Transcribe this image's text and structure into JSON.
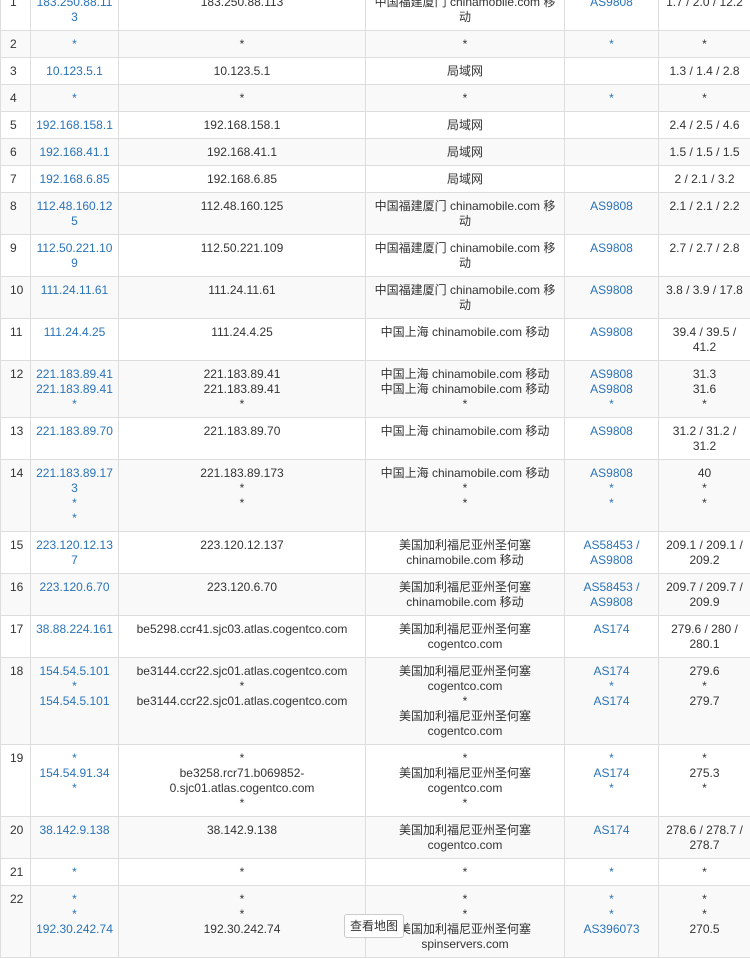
{
  "rows": [
    {
      "no": "1",
      "ip": [
        "183.250.88.113"
      ],
      "host": [
        "183.250.88.113"
      ],
      "loc": [
        "中国福建厦门 chinamobile.com 移动"
      ],
      "as": [
        "AS9808"
      ],
      "time": [
        "1.7 / 2.0 / 12.2"
      ]
    },
    {
      "no": "2",
      "ip": [
        "*"
      ],
      "host": [
        "*"
      ],
      "loc": [
        "*"
      ],
      "as": [
        "*"
      ],
      "time": [
        "*"
      ]
    },
    {
      "no": "3",
      "ip": [
        "10.123.5.1"
      ],
      "host": [
        "10.123.5.1"
      ],
      "loc": [
        "局域网"
      ],
      "as": [
        ""
      ],
      "time": [
        "1.3 / 1.4 / 2.8"
      ]
    },
    {
      "no": "4",
      "ip": [
        "*"
      ],
      "host": [
        "*"
      ],
      "loc": [
        "*"
      ],
      "as": [
        "*"
      ],
      "time": [
        "*"
      ]
    },
    {
      "no": "5",
      "ip": [
        "192.168.158.1"
      ],
      "host": [
        "192.168.158.1"
      ],
      "loc": [
        "局域网"
      ],
      "as": [
        ""
      ],
      "time": [
        "2.4 / 2.5 / 4.6"
      ]
    },
    {
      "no": "6",
      "ip": [
        "192.168.41.1"
      ],
      "host": [
        "192.168.41.1"
      ],
      "loc": [
        "局域网"
      ],
      "as": [
        ""
      ],
      "time": [
        "1.5 / 1.5 / 1.5"
      ]
    },
    {
      "no": "7",
      "ip": [
        "192.168.6.85"
      ],
      "host": [
        "192.168.6.85"
      ],
      "loc": [
        "局域网"
      ],
      "as": [
        ""
      ],
      "time": [
        "2 / 2.1 / 3.2"
      ]
    },
    {
      "no": "8",
      "ip": [
        "112.48.160.125"
      ],
      "host": [
        "112.48.160.125"
      ],
      "loc": [
        "中国福建厦门 chinamobile.com 移动"
      ],
      "as": [
        "AS9808"
      ],
      "time": [
        "2.1 / 2.1 / 2.2"
      ]
    },
    {
      "no": "9",
      "ip": [
        "112.50.221.109"
      ],
      "host": [
        "112.50.221.109"
      ],
      "loc": [
        "中国福建厦门 chinamobile.com 移动"
      ],
      "as": [
        "AS9808"
      ],
      "time": [
        "2.7 / 2.7 / 2.8"
      ]
    },
    {
      "no": "10",
      "ip": [
        "111.24.11.61"
      ],
      "host": [
        "111.24.11.61"
      ],
      "loc": [
        "中国福建厦门 chinamobile.com 移动"
      ],
      "as": [
        "AS9808"
      ],
      "time": [
        "3.8 / 3.9 / 17.8"
      ]
    },
    {
      "no": "11",
      "ip": [
        "111.24.4.25"
      ],
      "host": [
        "111.24.4.25"
      ],
      "loc": [
        "中国上海 chinamobile.com 移动"
      ],
      "as": [
        "AS9808"
      ],
      "time": [
        "39.4 / 39.5 /",
        "41.2"
      ]
    },
    {
      "no": "12",
      "ip": [
        "221.183.89.41",
        "221.183.89.41",
        "*"
      ],
      "host": [
        "221.183.89.41",
        "221.183.89.41",
        "*"
      ],
      "loc": [
        "中国上海 chinamobile.com 移动",
        "中国上海 chinamobile.com 移动",
        "*"
      ],
      "as": [
        "AS9808",
        "AS9808",
        "*"
      ],
      "time": [
        "31.3",
        "31.6",
        "*"
      ]
    },
    {
      "no": "13",
      "ip": [
        "221.183.89.70"
      ],
      "host": [
        "221.183.89.70"
      ],
      "loc": [
        "中国上海 chinamobile.com 移动"
      ],
      "as": [
        "AS9808"
      ],
      "time": [
        "31.2 / 31.2 /",
        "31.2"
      ]
    },
    {
      "no": "14",
      "ip": [
        "221.183.89.173",
        "*",
        "*"
      ],
      "host": [
        "221.183.89.173",
        "*",
        "*"
      ],
      "loc": [
        "中国上海 chinamobile.com 移动",
        "*",
        "*"
      ],
      "as": [
        "AS9808",
        "*",
        "*"
      ],
      "time": [
        "40",
        "*",
        "*"
      ]
    },
    {
      "no": "15",
      "ip": [
        "223.120.12.137"
      ],
      "host": [
        "223.120.12.137"
      ],
      "loc": [
        "美国加利福尼亚州圣何塞",
        "chinamobile.com 移动"
      ],
      "as": [
        "AS58453 /",
        "AS9808"
      ],
      "time": [
        "209.1 / 209.1 /",
        "209.2"
      ]
    },
    {
      "no": "16",
      "ip": [
        "223.120.6.70"
      ],
      "host": [
        "223.120.6.70"
      ],
      "loc": [
        "美国加利福尼亚州圣何塞",
        "chinamobile.com 移动"
      ],
      "as": [
        "AS58453 /",
        "AS9808"
      ],
      "time": [
        "209.7 / 209.7 /",
        "209.9"
      ]
    },
    {
      "no": "17",
      "ip": [
        "38.88.224.161"
      ],
      "host": [
        "be5298.ccr41.sjc03.atlas.cogentco.com"
      ],
      "loc": [
        "美国加利福尼亚州圣何塞",
        "cogentco.com"
      ],
      "as": [
        "AS174"
      ],
      "time": [
        "279.6 / 280 /",
        "280.1"
      ]
    },
    {
      "no": "18",
      "ip": [
        "154.54.5.101",
        "*",
        "154.54.5.101"
      ],
      "host": [
        "be3144.ccr22.sjc01.atlas.cogentco.com",
        "*",
        "be3144.ccr22.sjc01.atlas.cogentco.com"
      ],
      "loc": [
        "美国加利福尼亚州圣何塞",
        "cogentco.com",
        "*",
        "美国加利福尼亚州圣何塞",
        "cogentco.com"
      ],
      "as": [
        "AS174",
        "*",
        "AS174"
      ],
      "time": [
        "279.6",
        "*",
        "279.7"
      ]
    },
    {
      "no": "19",
      "ip": [
        "*",
        "154.54.91.34",
        "*"
      ],
      "host": [
        "*",
        "be3258.rcr71.b069852-",
        "0.sjc01.atlas.cogentco.com",
        "*"
      ],
      "loc": [
        "*",
        "美国加利福尼亚州圣何塞",
        "cogentco.com",
        "*"
      ],
      "as": [
        "*",
        "AS174",
        "*"
      ],
      "time": [
        "*",
        "275.3",
        "*"
      ]
    },
    {
      "no": "20",
      "ip": [
        "38.142.9.138"
      ],
      "host": [
        "38.142.9.138"
      ],
      "loc": [
        "美国加利福尼亚州圣何塞",
        "cogentco.com"
      ],
      "as": [
        "AS174"
      ],
      "time": [
        "278.6 / 278.7 /",
        "278.7"
      ]
    },
    {
      "no": "21",
      "ip": [
        "*"
      ],
      "host": [
        "*"
      ],
      "loc": [
        "*"
      ],
      "as": [
        "*"
      ],
      "time": [
        "*"
      ]
    },
    {
      "no": "22",
      "ip": [
        "*",
        "*",
        "192.30.242.74"
      ],
      "host": [
        "*",
        "*",
        "192.30.242.74"
      ],
      "loc": [
        "*",
        "*",
        "美国加利福尼亚州圣何塞",
        "spinservers.com"
      ],
      "as": [
        "*",
        "*",
        "AS396073"
      ],
      "time": [
        "*",
        "*",
        "270.5"
      ]
    }
  ],
  "map_button": "查看地图"
}
